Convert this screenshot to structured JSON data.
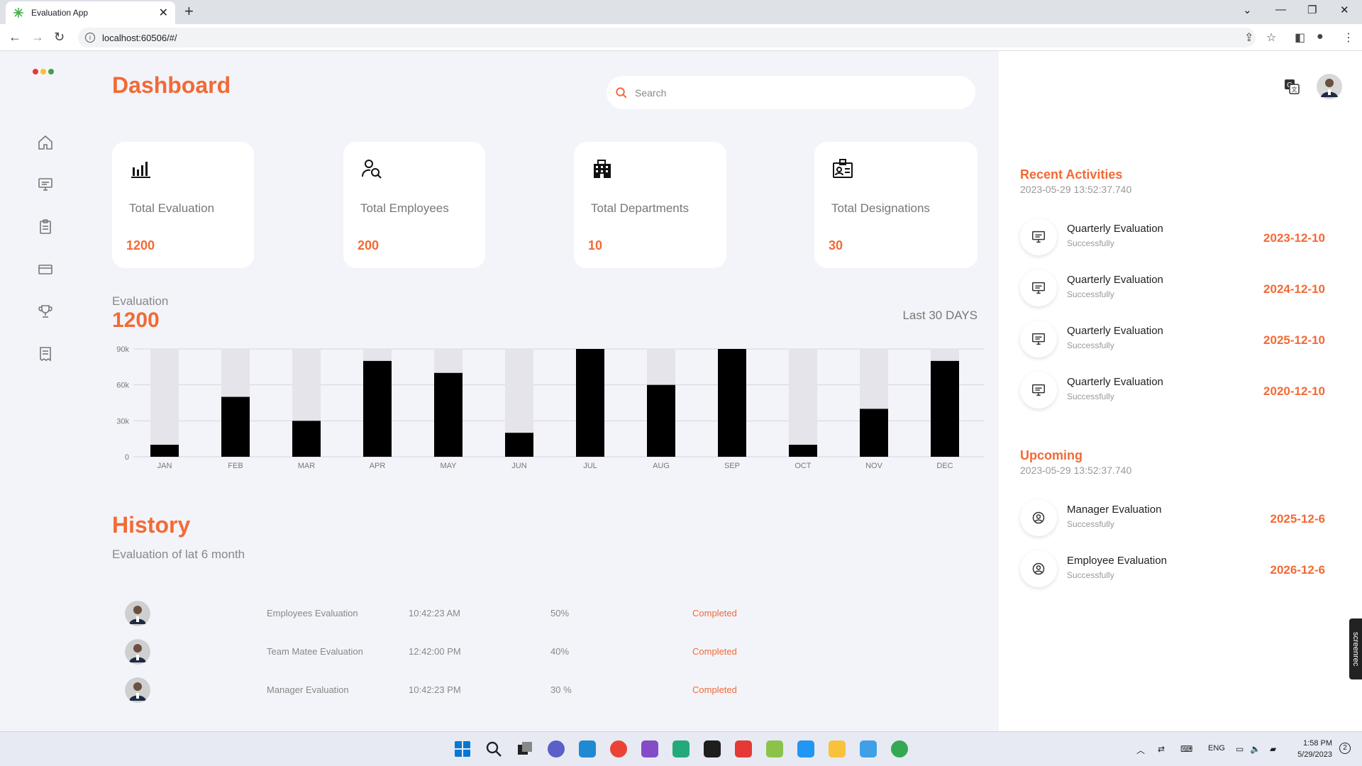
{
  "browser": {
    "tab_title": "Evaluation App",
    "url": "localhost:60506/#/"
  },
  "app": {
    "page_title": "Dashboard",
    "search_placeholder": "Search"
  },
  "cards": [
    {
      "label": "Total Evaluation",
      "value": "1200",
      "icon": "bar-chart-icon"
    },
    {
      "label": "Total Employees",
      "value": "200",
      "icon": "user-search-icon"
    },
    {
      "label": "Total Departments",
      "value": "10",
      "icon": "building-icon"
    },
    {
      "label": "Total Designations",
      "value": "30",
      "icon": "id-card-icon"
    }
  ],
  "evaluation": {
    "label": "Evaluation",
    "value": "1200",
    "range_label": "Last 30 DAYS"
  },
  "chart_data": {
    "type": "bar",
    "categories": [
      "JAN",
      "FEB",
      "MAR",
      "APR",
      "MAY",
      "JUN",
      "JUL",
      "AUG",
      "SEP",
      "OCT",
      "NOV",
      "DEC"
    ],
    "series": [
      {
        "values": [
          10000,
          50000,
          30000,
          80000,
          70000,
          20000,
          90000,
          60000,
          90000,
          10000,
          40000,
          80000
        ]
      }
    ],
    "background_max": 90000,
    "ylim": [
      0,
      90000
    ],
    "yticks": [
      {
        "v": 0,
        "label": "0"
      },
      {
        "v": 30000,
        "label": "30k"
      },
      {
        "v": 60000,
        "label": "60k"
      },
      {
        "v": 90000,
        "label": "90k"
      }
    ],
    "grid": true,
    "bar_color": "#000000",
    "bg_bar_color": "#e4e4ea"
  },
  "history": {
    "title": "History",
    "subtitle": "Evaluation of lat 6 month",
    "rows": [
      {
        "name": "Employees Evaluation",
        "time": "10:42:23 AM",
        "percent": "50%",
        "status": "Completed"
      },
      {
        "name": "Team Matee Evaluation",
        "time": "12:42:00 PM",
        "percent": "40%",
        "status": "Completed"
      },
      {
        "name": "Manager Evaluation",
        "time": "10:42:23 PM",
        "percent": "30 %",
        "status": "Completed"
      }
    ]
  },
  "recent": {
    "title": "Recent Activities",
    "timestamp": "2023-05-29 13:52:37.740",
    "items": [
      {
        "name": "Quarterly Evaluation",
        "sub": "Successfully",
        "date": "2023-12-10"
      },
      {
        "name": "Quarterly Evaluation",
        "sub": "Successfully",
        "date": "2024-12-10"
      },
      {
        "name": "Quarterly Evaluation",
        "sub": "Successfully",
        "date": "2025-12-10"
      },
      {
        "name": "Quarterly Evaluation",
        "sub": "Successfully",
        "date": "2020-12-10"
      }
    ]
  },
  "upcoming": {
    "title": "Upcoming",
    "timestamp": "2023-05-29 13:52:37.740",
    "items": [
      {
        "name": "Manager Evaluation",
        "sub": "Successfully",
        "date": "2025-12-6"
      },
      {
        "name": "Employee Evaluation",
        "sub": "Successfully",
        "date": "2026-12-6"
      }
    ]
  },
  "screenrec_label": "screenrec",
  "taskbar": {
    "lang": "ENG",
    "time": "1:58 PM",
    "date": "5/29/2023",
    "badge": "2"
  },
  "colors": {
    "accent": "#f26a35",
    "background": "#f3f4f9",
    "card": "#ffffff"
  }
}
